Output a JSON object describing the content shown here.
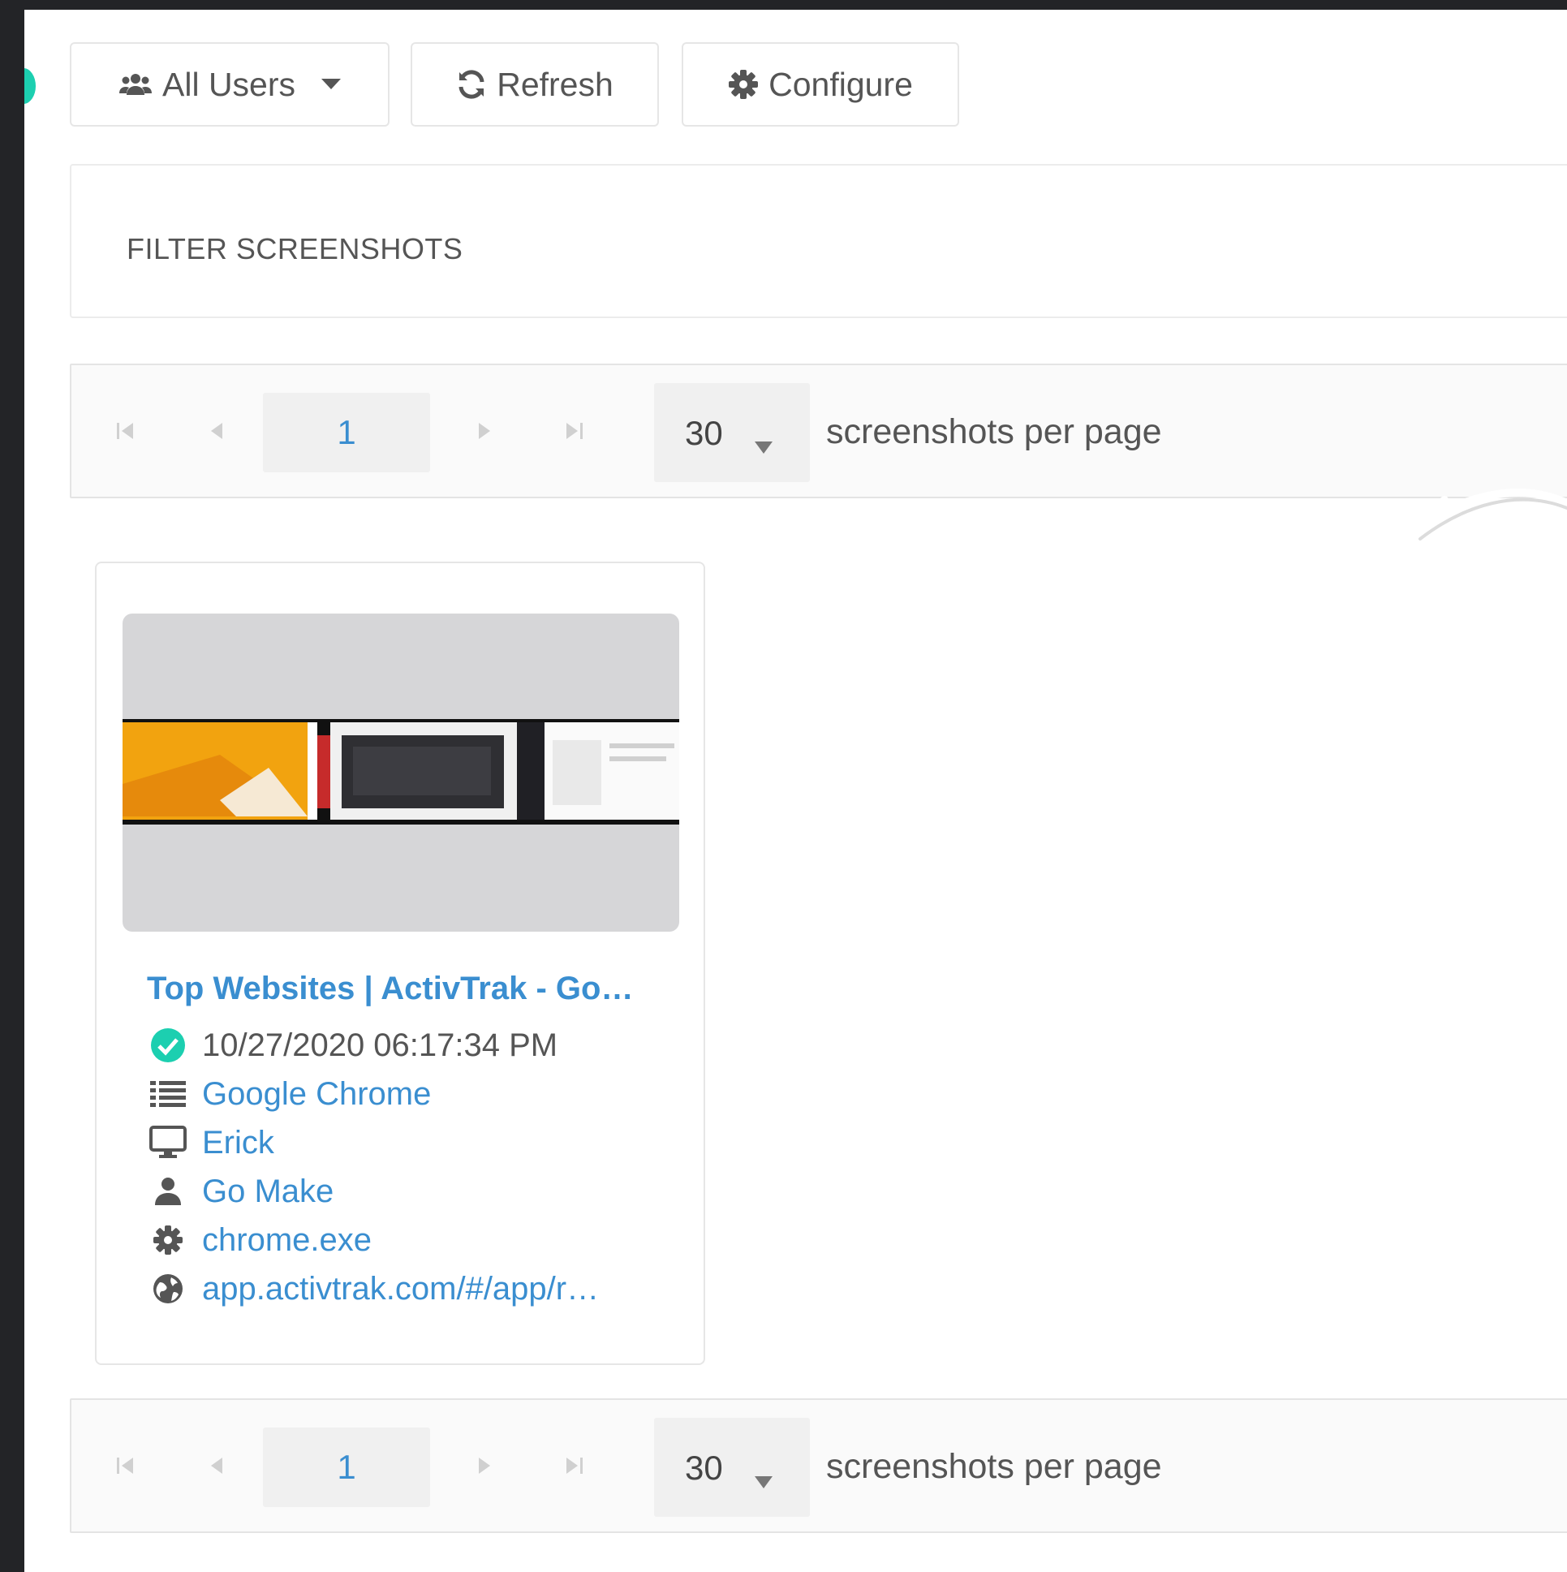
{
  "toolbar": {
    "users_label": "All Users",
    "refresh_label": "Refresh",
    "configure_label": "Configure"
  },
  "filter": {
    "title": "FILTER SCREENSHOTS"
  },
  "pager_top": {
    "current_page": "1",
    "per_page": "30",
    "per_page_label": "screenshots per page"
  },
  "pager_bottom": {
    "current_page": "1",
    "per_page": "30",
    "per_page_label": "screenshots per page"
  },
  "card": {
    "title": "Top Websites | ActivTrak - Go…",
    "timestamp": "10/27/2020 06:17:34 PM",
    "application": "Google Chrome",
    "computer": "Erick",
    "user": "Go Make",
    "executable": "chrome.exe",
    "url": "app.activtrak.com/#/app/r…"
  },
  "colors": {
    "link": "#3a8ed0",
    "success": "#1ccfb0",
    "frame": "#232427"
  },
  "icons": {
    "users": "users-icon",
    "refresh": "refresh-icon",
    "configure": "gear-icon",
    "timestamp": "check-circle-icon",
    "application": "list-icon",
    "computer": "monitor-icon",
    "user": "user-icon",
    "executable": "gear-icon",
    "url": "globe-icon"
  }
}
